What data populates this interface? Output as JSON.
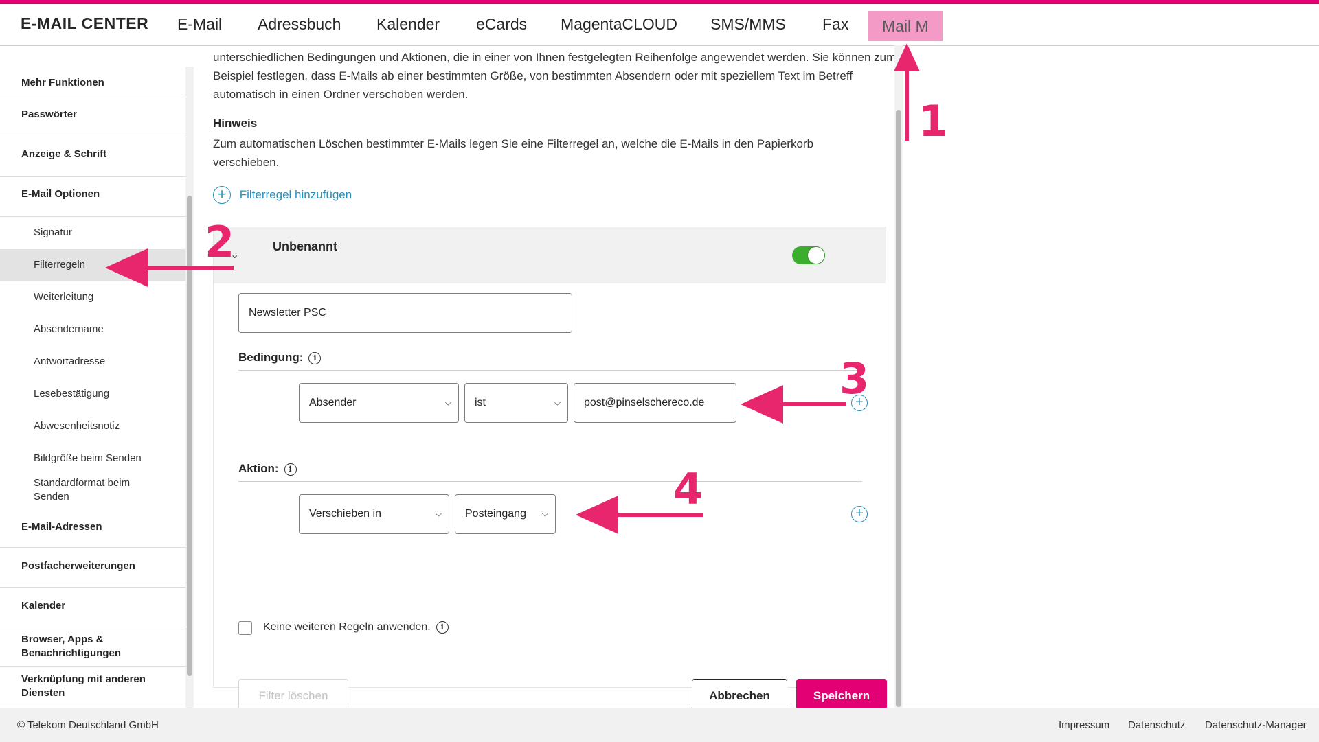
{
  "colors": {
    "brand": "#e20074",
    "annotation": "#e8266d",
    "link": "#2a8fb7",
    "toggle_on": "#3cae2e"
  },
  "header": {
    "brand": "E-MAIL CENTER",
    "nav": [
      "E-Mail",
      "Adressbuch",
      "Kalender",
      "eCards",
      "MagentaCLOUD",
      "SMS/MMS",
      "Fax"
    ],
    "active_nav": "Mail M"
  },
  "sidebar": {
    "items": [
      "Mehr Funktionen",
      "Passwörter",
      "Anzeige & Schrift",
      "E-Mail Optionen"
    ],
    "subitems": [
      "Signatur",
      "Filterregeln",
      "Weiterleitung",
      "Absendername",
      "Antwortadresse",
      "Lesebestätigung",
      "Abwesenheitsnotiz",
      "Bildgröße beim Senden",
      "Standardformat beim Senden"
    ],
    "items_after": [
      "E-Mail-Adressen",
      "Postfacherweiterungen",
      "Kalender",
      "Browser, Apps & Benachrichtigungen",
      "Verknüpfung mit anderen Diensten"
    ]
  },
  "main": {
    "intro": "unterschiedlichen Bedingungen und Aktionen, die in einer von Ihnen festgelegten Reihenfolge angewendet werden. Sie können zum Beispiel festlegen, dass E-Mails ab einer bestimmten Größe, von bestimmten Absendern oder mit speziellem Text im Betreff automatisch in einen Ordner verschoben werden.",
    "hint_title": "Hinweis",
    "hint_text": "Zum automatischen Löschen bestimmter E-Mails legen Sie eine Filterregel an, welche die E-Mails in den Papierkorb verschieben.",
    "add_rule": "Filterregel hinzufügen",
    "rule": {
      "title": "Unbenannt",
      "enabled": true,
      "name_value": "Newsletter PSC",
      "condition_label": "Bedingung:",
      "condition_field": "Absender",
      "condition_operator": "ist",
      "condition_value": "post@pinselschereco.de",
      "action_label": "Aktion:",
      "action_type": "Verschieben in",
      "action_target": "Posteingang",
      "stop_label": "Keine weiteren Regeln anwenden.",
      "delete_button": "Filter löschen",
      "cancel_button": "Abbrechen",
      "save_button": "Speichern"
    }
  },
  "footer": {
    "copyright": "© Telekom Deutschland GmbH",
    "links": [
      "Impressum",
      "Datenschutz",
      "Datenschutz-Manager"
    ]
  },
  "annotations": [
    "1",
    "2",
    "3",
    "4"
  ]
}
